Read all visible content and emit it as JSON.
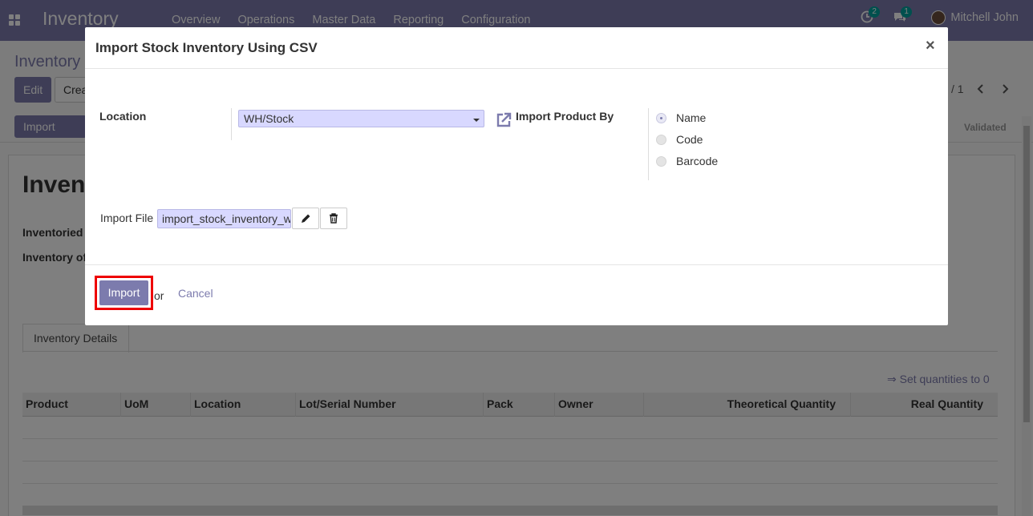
{
  "navbar": {
    "brand": "Inventory",
    "menu": [
      "Overview",
      "Operations",
      "Master Data",
      "Reporting",
      "Configuration"
    ],
    "activities_count": "2",
    "messages_count": "1",
    "user_name": "Mitchell John",
    "accent_color": "#7c7bad"
  },
  "background": {
    "breadcrumb": "Inventory",
    "edit_label": "Edit",
    "create_label": "Crea",
    "pager": "/ 1",
    "import_btn_label": "Import Inven",
    "status_validated": "Validated",
    "sheet_title": "Invent",
    "field_inventoried": "Inventoried",
    "field_inventory_of": "Inventory of",
    "tab_label": "Inventory Details",
    "set_quantities": "⇒ Set quantities to 0",
    "columns": [
      "Product",
      "UoM",
      "Location",
      "Lot/Serial Number",
      "Pack",
      "Owner",
      "Theoretical Quantity",
      "Real Quantity"
    ]
  },
  "modal": {
    "title": "Import Stock Inventory Using CSV",
    "close_symbol": "×",
    "location_label": "Location",
    "location_value": "WH/Stock",
    "import_by_label": "Import Product By",
    "import_by_options": [
      "Name",
      "Code",
      "Barcode"
    ],
    "import_by_selected": "Name",
    "import_file_label": "Import File",
    "import_file_value": "import_stock_inventory_with_name.csv",
    "import_label": "Import",
    "or_text": "or",
    "cancel_label": "Cancel"
  }
}
